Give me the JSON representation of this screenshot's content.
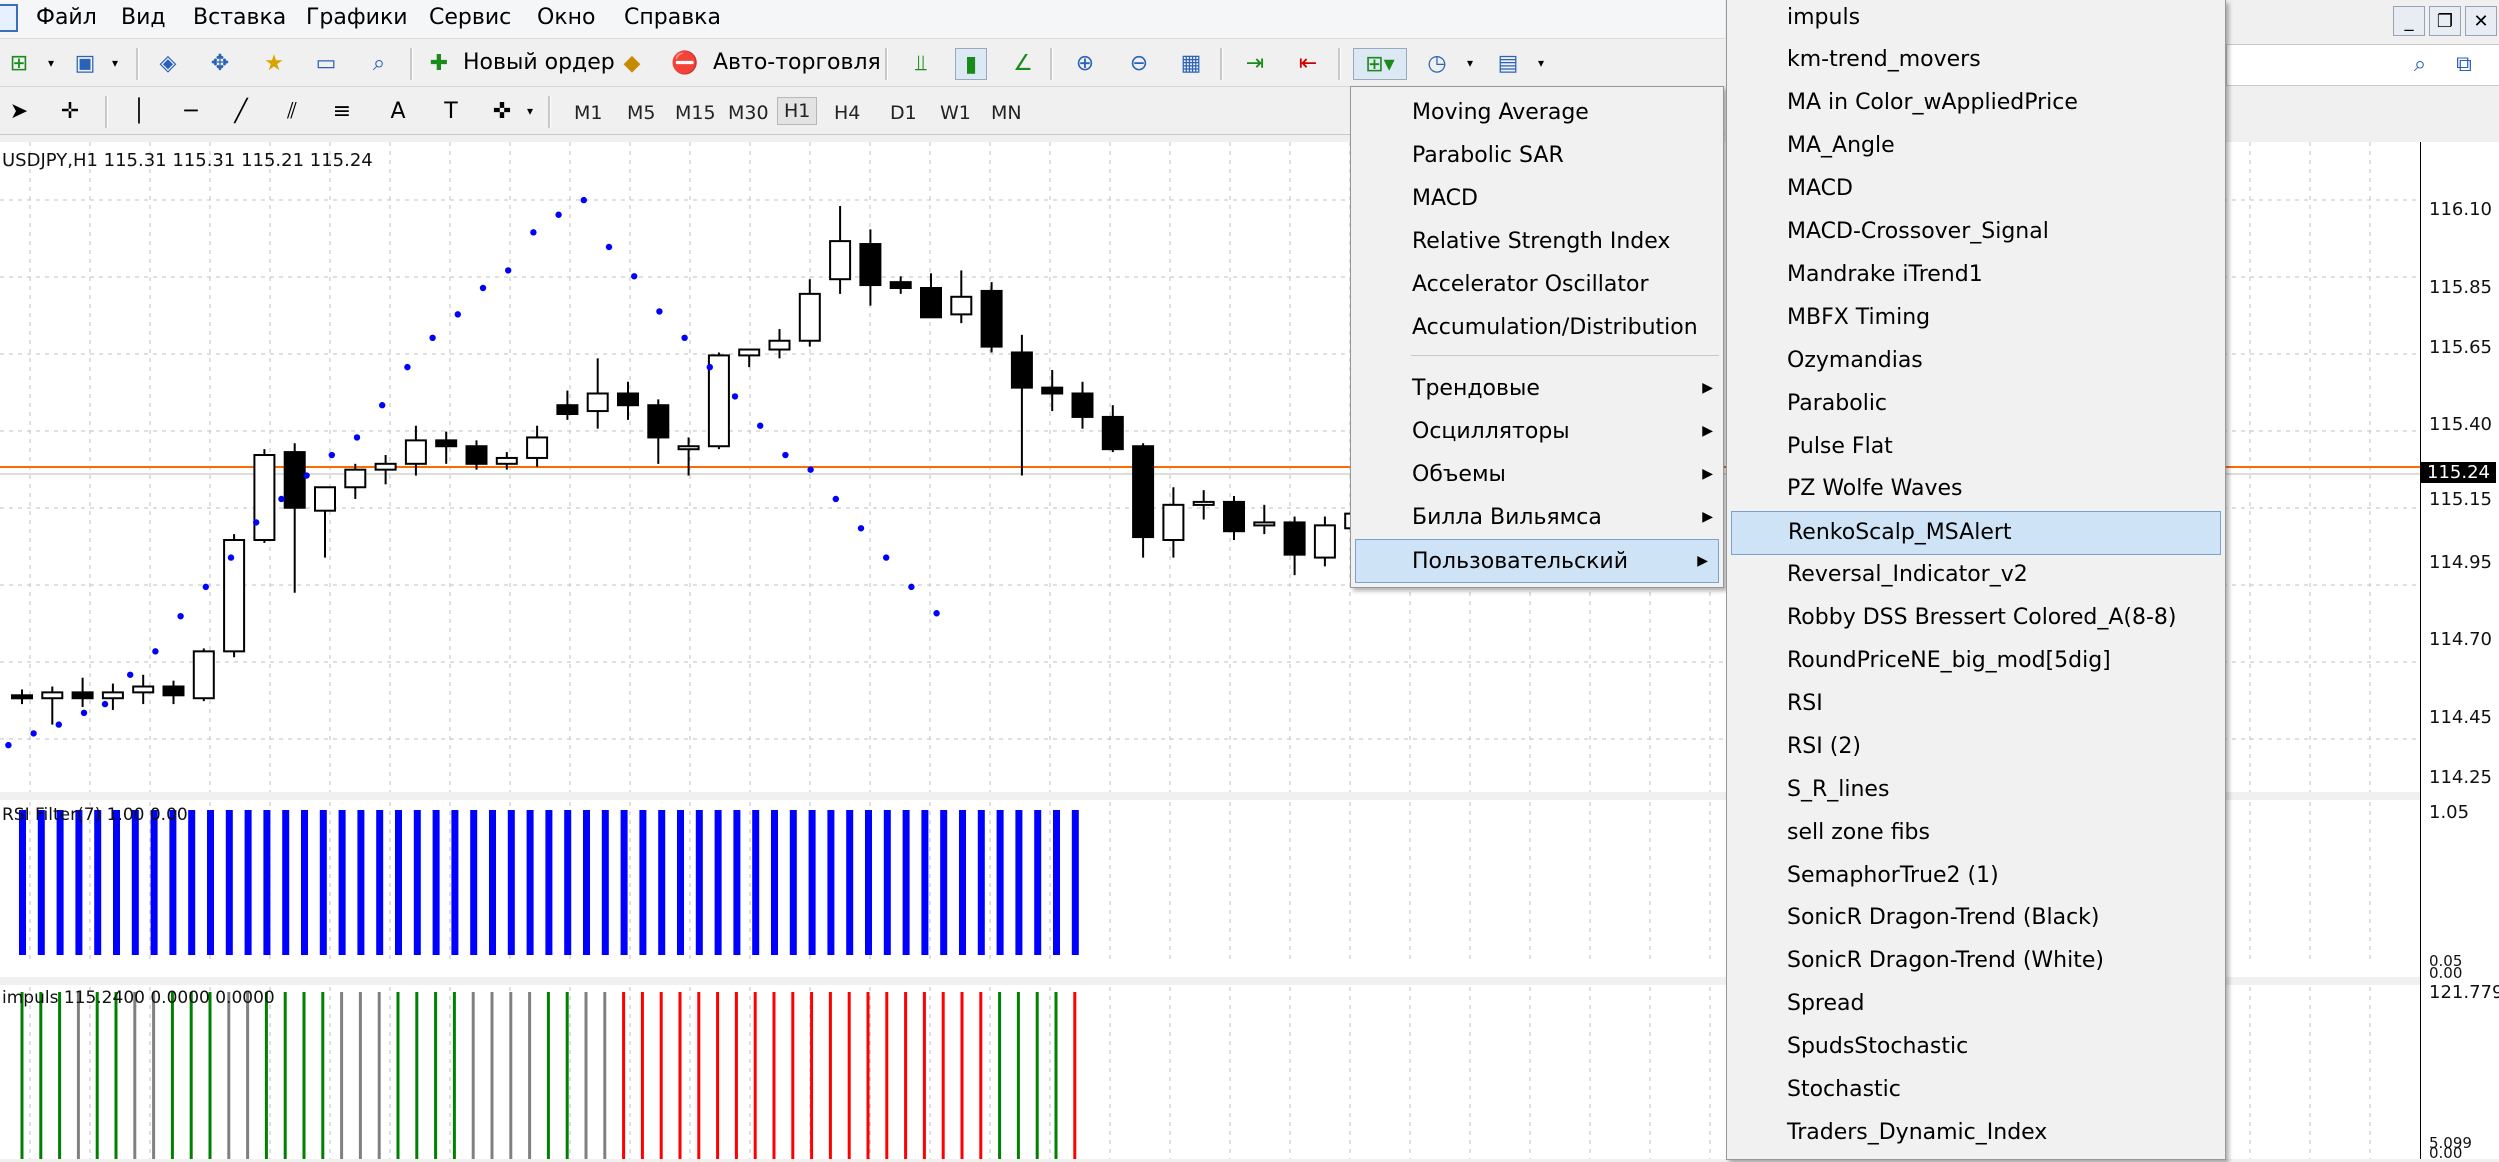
{
  "menubar": {
    "items": [
      "Файл",
      "Вид",
      "Вставка",
      "Графики",
      "Сервис",
      "Окно",
      "Справка"
    ]
  },
  "toolbar": {
    "new_order": "Новый ордер",
    "auto_trading": "Авто-торговля",
    "timeframes": [
      "M1",
      "M5",
      "M15",
      "M30",
      "H1",
      "H4",
      "D1",
      "W1",
      "MN"
    ],
    "active_timeframe": "H1"
  },
  "chart": {
    "header": "USDJPY,H1  115.31 115.31 115.21 115.24",
    "price_labels": [
      "116.10",
      "115.85",
      "115.65",
      "115.40",
      "115.24",
      "115.15",
      "114.95",
      "114.70",
      "114.45",
      "114.25"
    ],
    "current_price": "115.24",
    "rsi_label": "RSI Filter(7) 1.00 0.00",
    "rsi_axis": [
      "1.05",
      "0.05",
      "0.00"
    ],
    "impuls_label": "impuls 115.2400 0.0000 0.0000",
    "impuls_axis": [
      "121.779",
      "5.099",
      "0.00"
    ],
    "colors": {
      "bull": "#ffffff",
      "bear": "#000000",
      "sar": "#0000ff",
      "price_line": "#ff6a00",
      "rsi_bars": "#0000ff",
      "impuls_green": "#008000",
      "impuls_gray": "#808080",
      "impuls_red": "#ff0000"
    }
  },
  "indicators_menu": {
    "items": [
      "Moving Average",
      "Parabolic SAR",
      "MACD",
      "Relative Strength Index",
      "Accelerator Oscillator",
      "Accumulation/Distribution"
    ],
    "groups": [
      "Трендовые",
      "Осцилляторы",
      "Объемы",
      "Билла Вильямса",
      "Пользовательский"
    ],
    "highlighted": "Пользовательский"
  },
  "custom_submenu": {
    "items": [
      "impuls",
      "km-trend_movers",
      "MA in Color_wAppliedPrice",
      "MA_Angle",
      "MACD",
      "MACD-Crossover_Signal",
      "Mandrake iTrend1",
      "MBFX Timing",
      "Ozymandias",
      "Parabolic",
      "Pulse Flat",
      "PZ Wolfe Waves",
      "RenkoScalp_MSAlert",
      "Reversal_Indicator_v2",
      "Robby DSS Bressert Colored_A(8-8)",
      "RoundPriceNE_big_mod[5dig]",
      "RSI",
      "RSI (2)",
      "S_R_lines",
      "sell zone fibs",
      "SemaphorTrue2 (1)",
      "SonicR Dragon-Trend (Black)",
      "SonicR Dragon-Trend (White)",
      "Spread",
      "SpudsStochastic",
      "Stochastic",
      "Traders_Dynamic_Index"
    ],
    "highlighted": "RenkoScalp_MSAlert"
  }
}
